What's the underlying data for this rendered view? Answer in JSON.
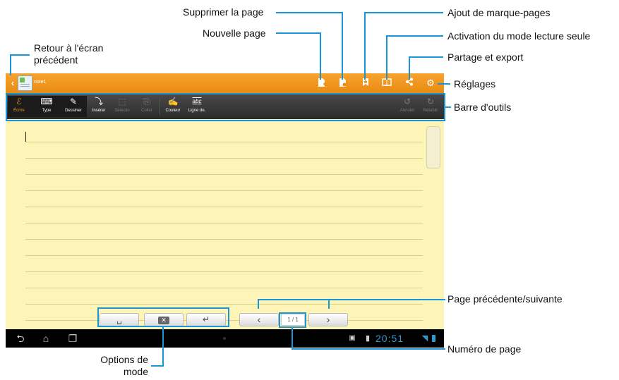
{
  "app": {
    "note_title": "note1"
  },
  "callouts": {
    "back": "Retour à l'écran précédent",
    "delete_page": "Supprimer la page",
    "new_page": "Nouvelle page",
    "add_bookmark": "Ajout de marque-pages",
    "read_only": "Activation du mode lecture seule",
    "share_export": "Partage et export",
    "settings": "Réglages",
    "toolbar": "Barre d'outils",
    "page_prev_next": "Page précédente/suivante",
    "page_number": "Numéro de page",
    "mode_options": "Options de mode"
  },
  "toolbar": {
    "write": "Écrire",
    "type": "Type",
    "draw": "Dessiner",
    "insert": "Insérer",
    "selection": "Sélectio",
    "paste": "Coller",
    "color": "Couleur",
    "line": "Ligne de.",
    "undo": "Annuler",
    "redo": "Rétablir"
  },
  "pagination": {
    "indicator": "1  /  1"
  },
  "statusbar": {
    "time": "20:51"
  },
  "colors": {
    "callout_line": "#1a96d8",
    "titlebar": "#f39b24",
    "toolbar": "#333333",
    "paper": "#fdf5b8"
  },
  "icons": {
    "back": "chevron-left-icon",
    "new_page": "new-page-icon",
    "delete_page": "delete-page-icon",
    "bookmark": "bookmark-icon",
    "read_only": "open-book-icon",
    "share": "share-icon",
    "settings": "gear-icon"
  }
}
